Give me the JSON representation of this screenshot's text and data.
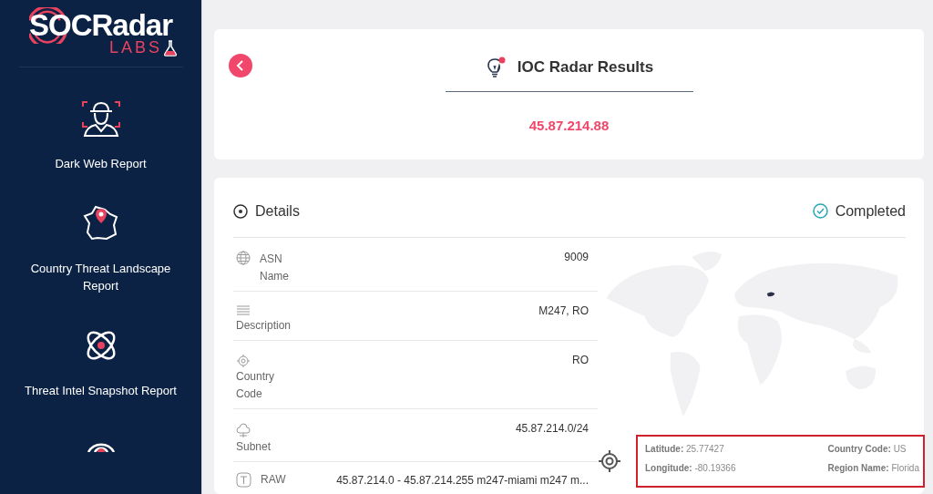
{
  "sidebar": {
    "logo": {
      "name": "SOCRadar",
      "sub": "LABS"
    },
    "items": [
      {
        "label": "Dark Web Report"
      },
      {
        "label": "Country Threat Landscape Report"
      },
      {
        "label": "Threat Intel Snapshot Report"
      }
    ]
  },
  "header": {
    "title": "IOC Radar Results",
    "ioc": "45.87.214.88"
  },
  "details": {
    "title": "Details",
    "status": "Completed",
    "rows": [
      {
        "kind": "inline",
        "label": "ASN Name",
        "value": "9009"
      },
      {
        "kind": "stacked",
        "label": "Description",
        "value": "M247, RO"
      },
      {
        "kind": "stacked",
        "label": "Country Code",
        "value": "RO"
      },
      {
        "kind": "stacked",
        "label": "Subnet",
        "value": "45.87.214.0/24"
      },
      {
        "kind": "inline",
        "label": "RAW",
        "value": "45.87.214.0 - 45.87.214.255 m247-miami m247 m..."
      }
    ],
    "location": [
      {
        "label": "Latitude:",
        "value": "25.77427"
      },
      {
        "label": "Country Code:",
        "value": "US"
      },
      {
        "label": "Longitude:",
        "value": "-80.19366"
      },
      {
        "label": "Region Name:",
        "value": "Florida"
      }
    ]
  }
}
